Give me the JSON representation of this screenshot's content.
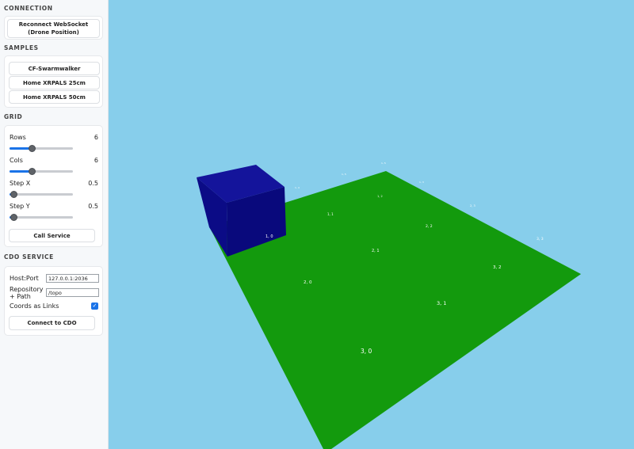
{
  "sidebar": {
    "connection": {
      "title": "CONNECTION",
      "reconnect_label": "Reconnect WebSocket (Drone Position)"
    },
    "samples": {
      "title": "SAMPLES",
      "items": [
        {
          "label": "CF-Swarmwalker"
        },
        {
          "label": "Home XRPALS 25cm"
        },
        {
          "label": "Home XRPALS 50cm"
        }
      ]
    },
    "grid": {
      "title": "GRID",
      "rows": {
        "label": "Rows",
        "value": "6"
      },
      "cols": {
        "label": "Cols",
        "value": "6"
      },
      "step_x": {
        "label": "Step X",
        "value": "0.5"
      },
      "step_y": {
        "label": "Step Y",
        "value": "0.5"
      },
      "call_service_label": "Call Service"
    },
    "cdo": {
      "title": "CDO SERVICE",
      "host_label": "Host:Port",
      "host_value": "127.0.0.1:2036",
      "repo_label": "Repository + Path",
      "repo_value": "/topo",
      "coords_label": "Coords as Links",
      "coords_checked": true,
      "connect_label": "Connect to CDO"
    }
  },
  "scene": {
    "sky_color": "#87ceeb",
    "ground_color": "#139a0d",
    "cube_color": "#0b0b8a",
    "coord_labels": [
      {
        "text": "3, 0"
      },
      {
        "text": "2, 0"
      },
      {
        "text": "1, 0"
      },
      {
        "text": "3, 1"
      },
      {
        "text": "2, 1"
      },
      {
        "text": "1, 1"
      },
      {
        "text": "3, 2"
      },
      {
        "text": "2, 2"
      },
      {
        "text": "1, 2"
      },
      {
        "text": "3, 3"
      },
      {
        "text": "2, 3"
      },
      {
        "text": "1, 3"
      },
      {
        "text": "1, 4"
      },
      {
        "text": "1, 5"
      }
    ]
  }
}
